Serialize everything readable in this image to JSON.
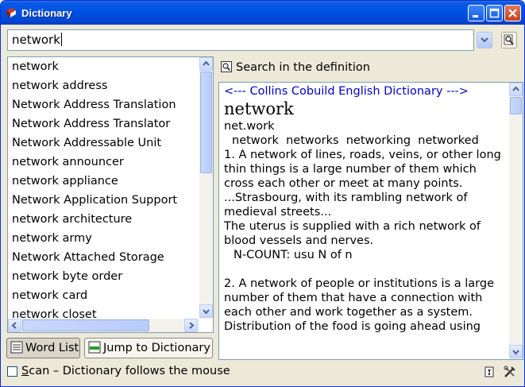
{
  "window": {
    "title": "Dictionary"
  },
  "search": {
    "value": "network"
  },
  "word_list": {
    "items": [
      "network",
      "network address",
      "Network Address Translation",
      "Network Address Translator",
      "Network Addressable Unit",
      "network announcer",
      "network appliance",
      "Network Application Support",
      "network architecture",
      "network army",
      "Network Attached Storage",
      "network byte order",
      "network card",
      "network closet"
    ]
  },
  "tabs": {
    "word_list": "Word List",
    "jump": "Jump to Dictionary"
  },
  "definition": {
    "header": "Search in the definition",
    "source": "<--- Collins Cobuild English Dictionary --->",
    "headword": "network",
    "syllables": "net.work",
    "forms": "network  networks  networking  networked",
    "lines": [
      "1. A network of lines, roads, veins, or other long thin things is a large number of them which cross each other or meet at many points.",
      "...Strasbourg, with its rambling network of medieval streets...",
      "The uterus is supplied with a rich network of blood vessels and nerves."
    ],
    "grammar": "N-COUNT: usu N of n",
    "lines2": [
      "2. A network of people or institutions is a large number of them that have a connection with each other and work together as a system.",
      "Distribution of the food is going ahead using"
    ]
  },
  "status": {
    "scan_first": "S",
    "scan_rest": "can – Dictionary follows the mouse"
  }
}
